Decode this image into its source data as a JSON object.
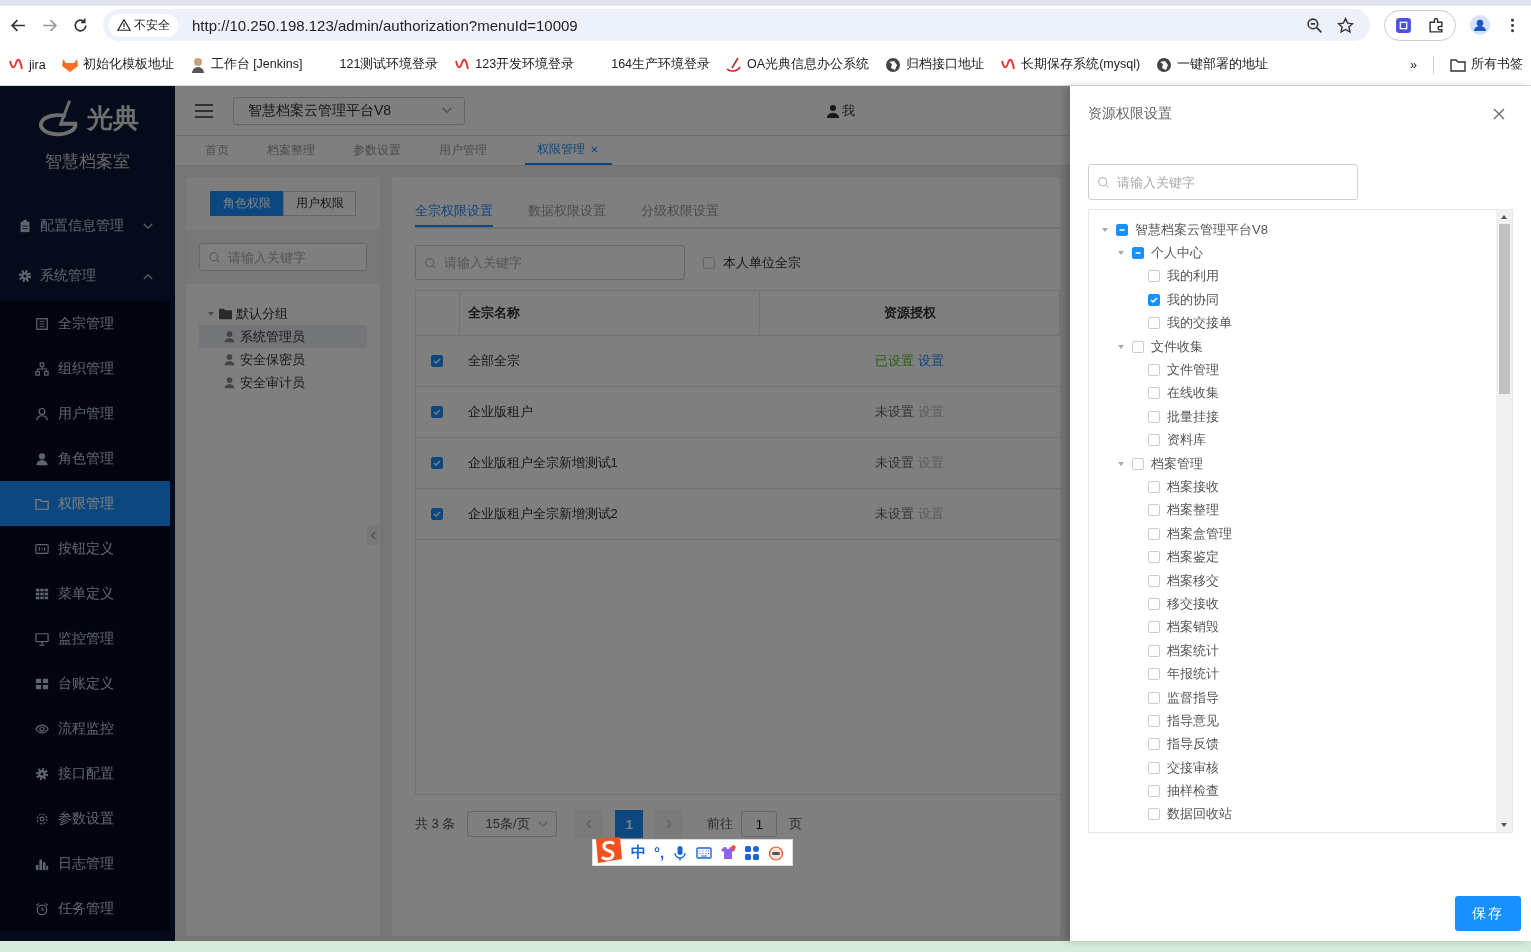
{
  "browser": {
    "security_label": "不安全",
    "url": "http://10.250.198.123/admin/authorization?menuId=10009",
    "bookmarks": [
      {
        "label": "jira",
        "kind": "swirl"
      },
      {
        "label": "初始化模板地址",
        "kind": "fox"
      },
      {
        "label": "工作台 [Jenkins]",
        "kind": "person"
      },
      {
        "label": "121测试环境登录",
        "kind": "plain"
      },
      {
        "label": "123开发环境登录",
        "kind": "swirl"
      },
      {
        "label": "164生产环境登录",
        "kind": "plain"
      },
      {
        "label": "OA光典信息办公系统",
        "kind": "quill"
      },
      {
        "label": "归档接口地址",
        "kind": "globe"
      },
      {
        "label": "长期保存系统(mysql)",
        "kind": "swirl"
      },
      {
        "label": "一键部署的地址",
        "kind": "globe"
      }
    ],
    "overflow": "»",
    "all_bookmarks": "所有书签"
  },
  "sidebar": {
    "logo": "光典",
    "subtitle": "智慧档案室",
    "groups": [
      {
        "label": "配置信息管理",
        "kind": "clipboard",
        "expanded": false
      },
      {
        "label": "系统管理",
        "kind": "gear",
        "expanded": true,
        "items": [
          {
            "label": "全宗管理",
            "kind": "doc",
            "selected": false
          },
          {
            "label": "组织管理",
            "kind": "org",
            "selected": false
          },
          {
            "label": "用户管理",
            "kind": "user",
            "selected": false
          },
          {
            "label": "角色管理",
            "kind": "user-solid",
            "selected": false
          },
          {
            "label": "权限管理",
            "kind": "folder",
            "selected": true
          },
          {
            "label": "按钮定义",
            "kind": "button",
            "selected": false
          },
          {
            "label": "菜单定义",
            "kind": "grid",
            "selected": false
          },
          {
            "label": "监控管理",
            "kind": "monitor",
            "selected": false
          },
          {
            "label": "台账定义",
            "kind": "tiles",
            "selected": false
          },
          {
            "label": "流程监控",
            "kind": "eye",
            "selected": false
          },
          {
            "label": "接口配置",
            "kind": "gear",
            "selected": false
          },
          {
            "label": "参数设置",
            "kind": "cog",
            "selected": false
          },
          {
            "label": "日志管理",
            "kind": "bars",
            "selected": false
          },
          {
            "label": "任务管理",
            "kind": "alarm",
            "selected": false
          }
        ]
      }
    ]
  },
  "header": {
    "platform": "智慧档案云管理平台V8",
    "user": "我"
  },
  "tabs": [
    {
      "label": "首页",
      "selected": false
    },
    {
      "label": "档案整理",
      "selected": false
    },
    {
      "label": "参数设置",
      "selected": false
    },
    {
      "label": "用户管理",
      "selected": false
    },
    {
      "label": "权限管理",
      "selected": true
    }
  ],
  "left_panel": {
    "modes": [
      {
        "label": "角色权限",
        "selected": true
      },
      {
        "label": "用户权限",
        "selected": false
      }
    ],
    "search": {
      "placeholder": "请输入关键字"
    },
    "tree": [
      {
        "label": "默认分组",
        "expanded": true,
        "selected": false,
        "children": [
          {
            "label": "系统管理员",
            "selected": true
          },
          {
            "label": "安全保密员",
            "selected": false
          },
          {
            "label": "安全审计员",
            "selected": false
          }
        ]
      }
    ]
  },
  "main_panel": {
    "tabs": [
      {
        "label": "全宗权限设置",
        "selected": true
      },
      {
        "label": "数据权限设置",
        "selected": false
      },
      {
        "label": "分级权限设置",
        "selected": false
      }
    ],
    "search": {
      "placeholder": "请输入关键字"
    },
    "own_unit": {
      "label": "本人单位全宗",
      "checked": false
    },
    "table": {
      "columns": [
        "全宗名称",
        "资源授权"
      ],
      "rows": [
        {
          "checked": true,
          "name": "全部全宗",
          "status": "已设置",
          "configured": true,
          "action": "设置"
        },
        {
          "checked": true,
          "name": "企业版租户",
          "status": "未设置",
          "configured": false,
          "action": "设置"
        },
        {
          "checked": true,
          "name": "企业版租户全宗新增测试1",
          "status": "未设置",
          "configured": false,
          "action": "设置"
        },
        {
          "checked": true,
          "name": "企业版租户全宗新增测试2",
          "status": "未设置",
          "configured": false,
          "action": "设置"
        }
      ]
    },
    "pagination": {
      "total": "共 3 条",
      "page_size": "15条/页",
      "pages": [
        {
          "label": "1",
          "selected": true
        }
      ],
      "goto_label": "前往",
      "goto_value": "1",
      "page_suffix": "页"
    }
  },
  "drawer": {
    "title": "资源权限设置",
    "search": {
      "placeholder": "请输入关键字"
    },
    "tree": [
      {
        "label": "智慧档案云管理平台V8",
        "indeterminate": true,
        "expanded": true,
        "children": [
          {
            "label": "个人中心",
            "indeterminate": true,
            "expanded": true,
            "children": [
              {
                "label": "我的利用",
                "checked": false
              },
              {
                "label": "我的协同",
                "checked": true
              },
              {
                "label": "我的交接单",
                "checked": false
              }
            ]
          },
          {
            "label": "文件收集",
            "checked": false,
            "indeterminate": false,
            "expanded": true,
            "children": [
              {
                "label": "文件管理",
                "checked": false
              },
              {
                "label": "在线收集",
                "checked": false
              },
              {
                "label": "批量挂接",
                "checked": false
              },
              {
                "label": "资料库",
                "checked": false
              }
            ]
          },
          {
            "label": "档案管理",
            "checked": false,
            "indeterminate": false,
            "expanded": true,
            "children": [
              {
                "label": "档案接收",
                "checked": false
              },
              {
                "label": "档案整理",
                "checked": false
              },
              {
                "label": "档案盒管理",
                "checked": false
              },
              {
                "label": "档案鉴定",
                "checked": false
              },
              {
                "label": "档案移交",
                "checked": false
              },
              {
                "label": "移交接收",
                "checked": false
              },
              {
                "label": "档案销毁",
                "checked": false
              },
              {
                "label": "档案统计",
                "checked": false
              },
              {
                "label": "年报统计",
                "checked": false
              },
              {
                "label": "监督指导",
                "checked": false
              },
              {
                "label": "指导意见",
                "checked": false
              },
              {
                "label": "指导反馈",
                "checked": false
              },
              {
                "label": "交接审核",
                "checked": false
              },
              {
                "label": "抽样检查",
                "checked": false
              },
              {
                "label": "数据回收站",
                "checked": false
              }
            ]
          }
        ]
      }
    ],
    "save": "保存"
  },
  "ime": {
    "mode": "中",
    "punctuation": "°,"
  }
}
